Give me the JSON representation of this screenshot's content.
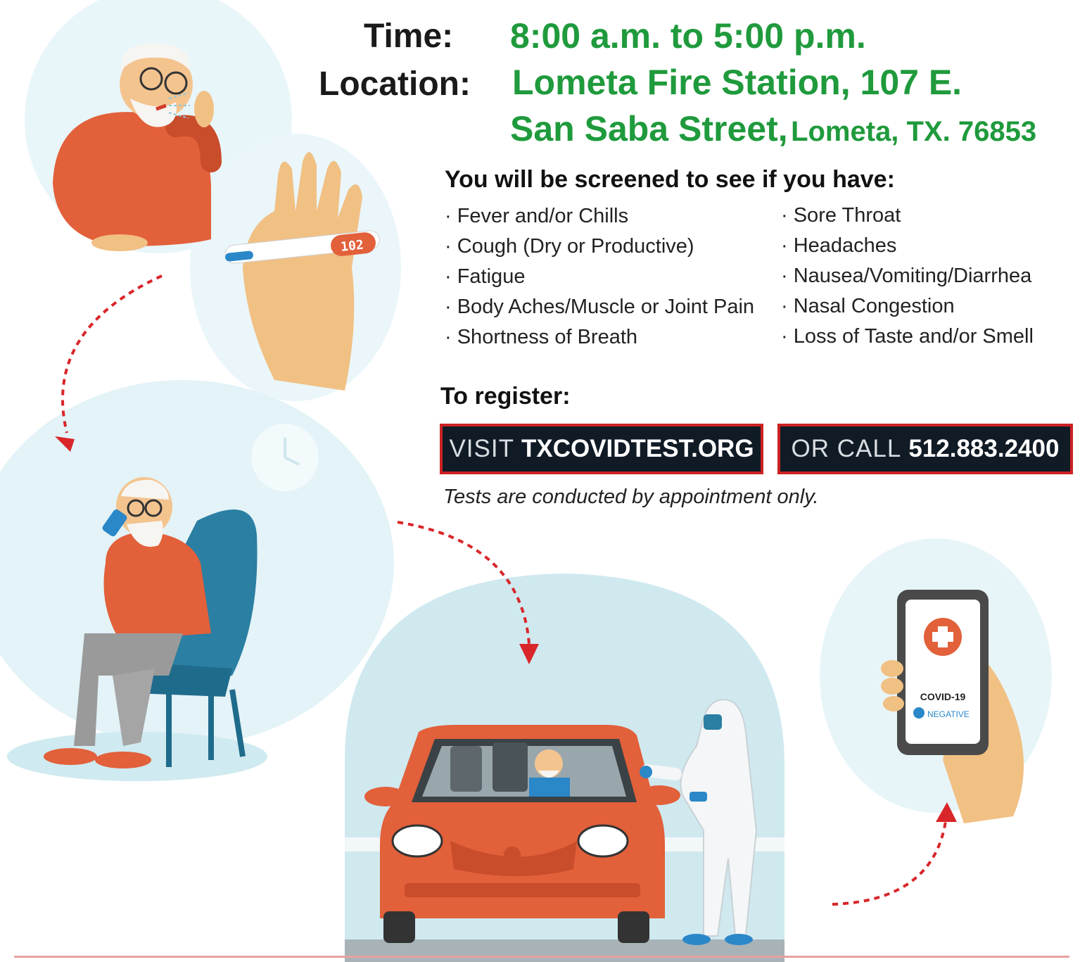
{
  "event": {
    "time_label": "Time:",
    "time_value": "8:00 a.m. to 5:00 p.m.",
    "location_label": "Location:",
    "location_line1": "Lometa Fire Station, 107 E.",
    "location_line2_main": "San Saba Street,",
    "location_line2_city": "Lometa, TX. 76853"
  },
  "screening": {
    "heading": "You will be screened to see if you have:",
    "col1": [
      "Fever and/or Chills",
      "Cough (Dry or Productive)",
      "Fatigue",
      "Body Aches/Muscle or Joint Pain",
      "Shortness of Breath"
    ],
    "col2": [
      "Sore Throat",
      "Headaches",
      "Nausea/Vomiting/Diarrhea",
      "Nasal Congestion",
      "Loss of Taste and/or Smell"
    ]
  },
  "register": {
    "heading": "To register:",
    "visit_prefix": "VISIT",
    "visit_site": "TXCOVIDTEST.ORG",
    "call_prefix": "OR CALL",
    "call_number": "512.883.2400",
    "note": "Tests are conducted by appointment only."
  },
  "illustrations": {
    "thermometer_text": "102",
    "phone_title": "COVID-19",
    "phone_status": "NEGATIVE"
  },
  "colors": {
    "green": "#1f9a3c",
    "orange": "#e2603a",
    "light_blue": "#cfeaf0",
    "dark": "#111b26",
    "red": "#d8262a"
  }
}
